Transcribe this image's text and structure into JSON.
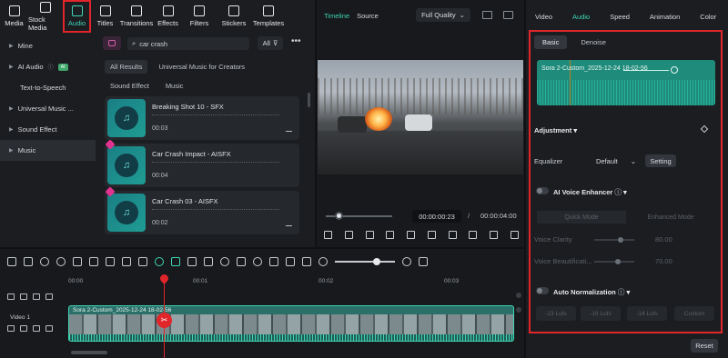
{
  "toolbar": {
    "items": [
      {
        "label": "Media",
        "icon": "media-icon"
      },
      {
        "label": "Stock Media",
        "icon": "stock-media-icon"
      },
      {
        "label": "Audio",
        "icon": "music-note-icon",
        "active": true
      },
      {
        "label": "Titles",
        "icon": "titles-icon"
      },
      {
        "label": "Transitions",
        "icon": "transitions-icon"
      },
      {
        "label": "Effects",
        "icon": "effects-icon"
      },
      {
        "label": "Filters",
        "icon": "filters-icon"
      },
      {
        "label": "Stickers",
        "icon": "stickers-icon"
      },
      {
        "label": "Templates",
        "icon": "templates-icon"
      }
    ]
  },
  "library": {
    "sidebar": [
      {
        "label": "Mine",
        "has_arrow": true
      },
      {
        "label": "AI Audio",
        "has_arrow": true,
        "badge": "AI"
      },
      {
        "label": "Text-to-Speech",
        "has_arrow": false
      },
      {
        "label": "Universal Music ...",
        "has_arrow": true
      },
      {
        "label": "Sound Effect",
        "has_arrow": true
      },
      {
        "label": "Music",
        "has_arrow": true
      }
    ],
    "search_value": "car crash",
    "filter_all": "All",
    "chips": [
      "All Results",
      "Universal Music for Creators",
      "Sound Effect",
      "Music"
    ],
    "cards": [
      {
        "title": "Breaking Shot 10 - SFX",
        "duration": "00:03",
        "premium": false
      },
      {
        "title": "Car Crash Impact - AISFX",
        "duration": "00:04",
        "premium": true
      },
      {
        "title": "Car Crash 03 - AISFX",
        "duration": "00:02",
        "premium": true
      }
    ]
  },
  "preview": {
    "tabs": [
      "Timeline",
      "Source"
    ],
    "quality": "Full Quality",
    "time_current": "00:00:00:23",
    "time_separator": "/",
    "time_total": "00:00:04:00",
    "progress": 0.15
  },
  "props": {
    "tabs": [
      "Video",
      "Audio",
      "Speed",
      "Animation",
      "Color"
    ],
    "active_tab": "Audio",
    "sub_tabs": [
      "Basic",
      "Denoise"
    ],
    "clip_name": "Sora 2-Custom_2025-12-24 18-02-56",
    "adjustment": "Adjustment",
    "equalizer_label": "Equalizer",
    "equalizer_value": "Default",
    "setting_button": "Setting",
    "ai_voice_enhancer": "AI Voice Enhancer",
    "modes": [
      "Quick Mode",
      "Enhanced Mode"
    ],
    "voice_clarity_label": "Voice Clarity",
    "voice_clarity_value": "80.00",
    "voice_beautification_label": "Voice Beautificati...",
    "voice_beautification_value": "70.00",
    "auto_normalization": "Auto Normalization",
    "lufs": [
      "-23 Lufs",
      "-16 Lufs",
      "-14 Lufs",
      "Custom"
    ],
    "reset": "Reset"
  },
  "timeline": {
    "ruler": [
      "00:00",
      "00:01",
      "00:02",
      "00:03"
    ],
    "track_label": "Video 1",
    "clip_name": "Sora 2-Custom_2025-12-24 18-02-56"
  }
}
